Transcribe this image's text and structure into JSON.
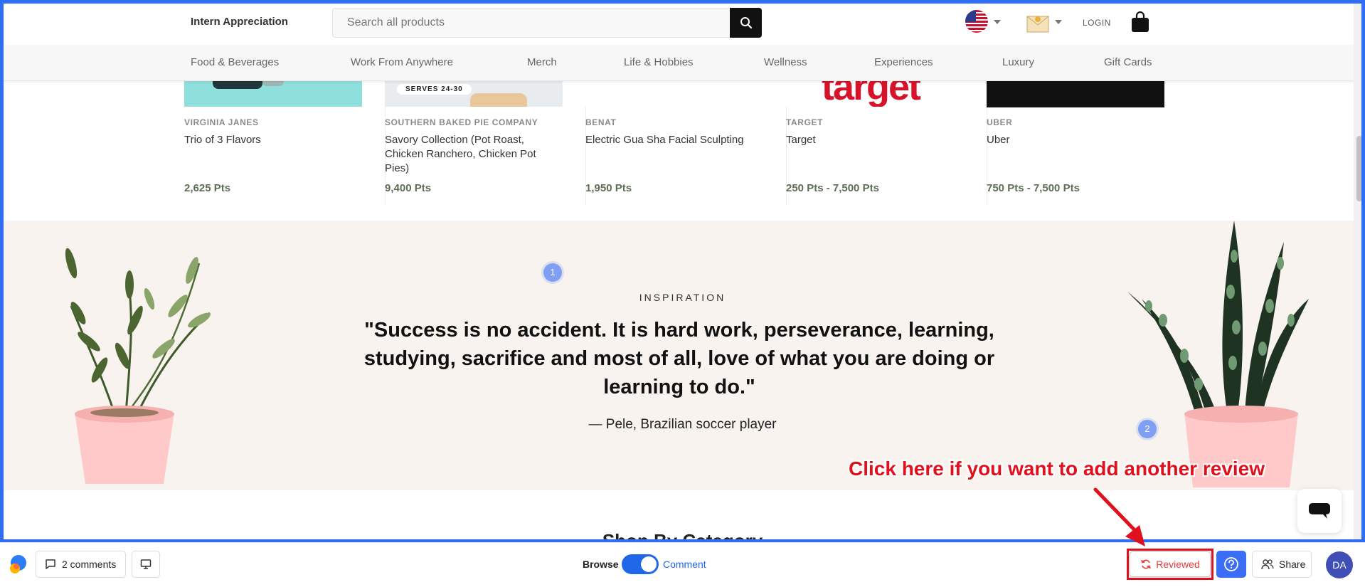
{
  "header": {
    "brand": "Intern Appreciation",
    "search_placeholder": "Search all products",
    "login_label": "LOGIN"
  },
  "nav": {
    "items": [
      "Food & Beverages",
      "Work From Anywhere",
      "Merch",
      "Life & Hobbies",
      "Wellness",
      "Experiences",
      "Luxury",
      "Gift Cards"
    ]
  },
  "products": [
    {
      "vendor": "VIRGINIA JANES",
      "name": "Trio of 3 Flavors",
      "price": "2,625 Pts"
    },
    {
      "vendor": "SOUTHERN BAKED PIE COMPANY",
      "name": "Savory Collection (Pot Roast, Chicken Ranchero, Chicken Pot Pies)",
      "price": "9,400 Pts",
      "badge": "SERVES 24-30"
    },
    {
      "vendor": "BENAT",
      "name": "Electric Gua Sha Facial Sculpting",
      "price": "1,950 Pts"
    },
    {
      "vendor": "TARGET",
      "name": "Target",
      "price": "250 Pts - 7,500 Pts",
      "logo_text": "target"
    },
    {
      "vendor": "UBER",
      "name": "Uber",
      "price": "750 Pts - 7,500 Pts"
    }
  ],
  "inspiration": {
    "label": "INSPIRATION",
    "quote": "\"Success is no accident. It is hard work, perseverance, learning, studying, sacrifice and most of all, love of what you are doing or learning to do.\"",
    "author": "— Pele, Brazilian soccer player"
  },
  "pins": [
    "1",
    "2"
  ],
  "annotation": "Click here if you want to add another review",
  "below_heading": "Shop By Category",
  "toolbar": {
    "comments_label": "2 comments",
    "browse_label": "Browse",
    "comment_label": "Comment",
    "reviewed_label": "Reviewed",
    "share_label": "Share",
    "avatar_initials": "DA"
  },
  "colors": {
    "frame_border": "#2f6df6",
    "price_text": "#5d6e55",
    "annotation": "#e0101d",
    "toggle_on": "#1f66e8",
    "inspiration_bg": "#f8f3ee"
  }
}
